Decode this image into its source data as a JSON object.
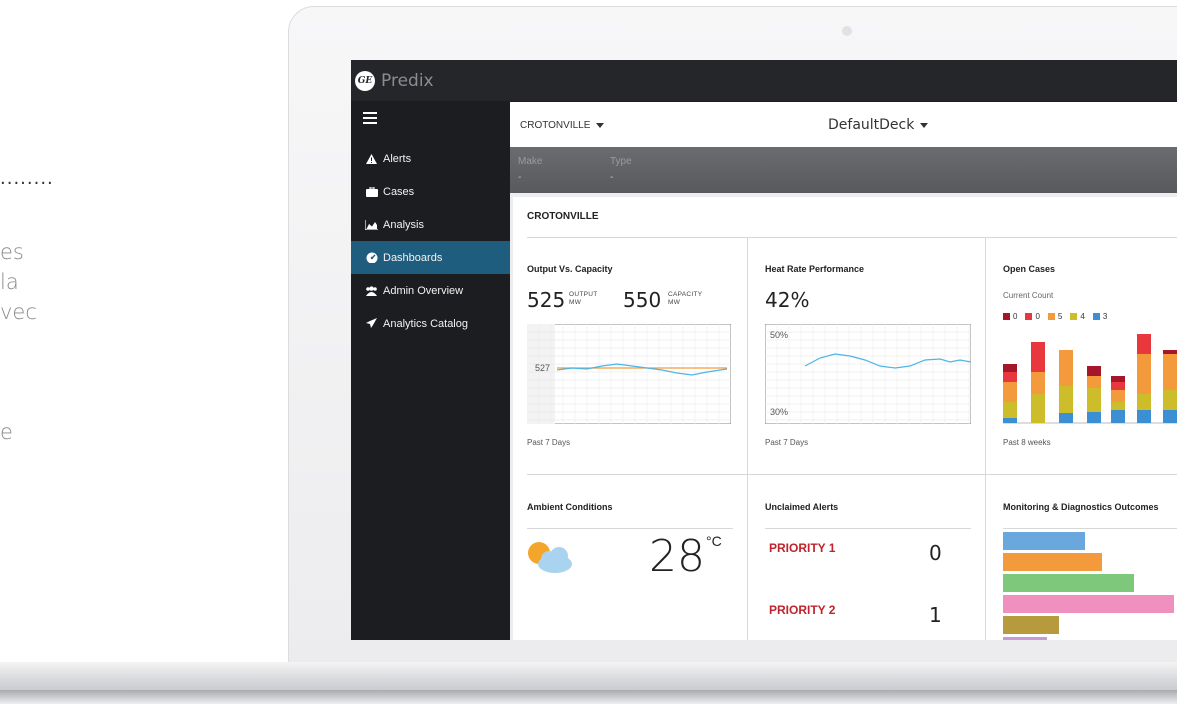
{
  "marketing_fragments": {
    "dots": "........",
    "line1": "es",
    "line2": "la",
    "line3": "vec",
    "line4": "e"
  },
  "app": {
    "brand": "Predix",
    "logo_text": "GE"
  },
  "sidebar": {
    "items": [
      {
        "label": "Alerts",
        "icon": "alert-triangle-icon",
        "active": false
      },
      {
        "label": "Cases",
        "icon": "briefcase-icon",
        "active": false
      },
      {
        "label": "Analysis",
        "icon": "area-chart-icon",
        "active": false
      },
      {
        "label": "Dashboards",
        "icon": "dashboard-gauge-icon",
        "active": true
      },
      {
        "label": "Admin Overview",
        "icon": "users-icon",
        "active": false
      },
      {
        "label": "Analytics Catalog",
        "icon": "rocket-icon",
        "active": false
      }
    ]
  },
  "context": {
    "site": "CROTONVILLE",
    "deck": "DefaultDeck",
    "make_label": "Make",
    "make_value": "-",
    "type_label": "Type",
    "type_value": "-"
  },
  "deck": {
    "title": "CROTONVILLE",
    "output_capacity": {
      "title": "Output Vs. Capacity",
      "output_value": "525",
      "output_unit_line1": "OUTPUT",
      "output_unit_line2": "MW",
      "capacity_value": "550",
      "capacity_unit_line1": "CAPACITY",
      "capacity_unit_line2": "MW",
      "marker_label": "527",
      "footer": "Past 7 Days",
      "colors": {
        "output": "#4cb5e6",
        "capacity": "#f39a3c"
      }
    },
    "heat_rate": {
      "title": "Heat Rate Performance",
      "value": "42%",
      "y_top": "50%",
      "y_bottom": "30%",
      "footer": "Past 7 Days",
      "color": "#4cb5e6"
    },
    "open_cases": {
      "title": "Open Cases",
      "subtitle": "Current Count",
      "legend": [
        {
          "value": "0",
          "color": "#a5162a"
        },
        {
          "value": "0",
          "color": "#e8383d"
        },
        {
          "value": "5",
          "color": "#f39a3c"
        },
        {
          "value": "4",
          "color": "#cdbd2a"
        },
        {
          "value": "3",
          "color": "#3d8fd4"
        }
      ],
      "footer": "Past 8 weeks"
    },
    "ambient": {
      "title": "Ambient Conditions",
      "temperature": "28",
      "unit": "°C",
      "icon": "partly-cloudy-icon"
    },
    "unclaimed_alerts": {
      "title": "Unclaimed Alerts",
      "rows": [
        {
          "label": "PRIORITY 1",
          "value": "0"
        },
        {
          "label": "PRIORITY 2",
          "value": "1"
        }
      ]
    },
    "md_outcomes": {
      "title": "Monitoring & Diagnostics Outcomes",
      "bars": [
        {
          "value": 0.47,
          "color": "#6aa7dd"
        },
        {
          "value": 0.57,
          "color": "#f39a3c"
        },
        {
          "value": 0.75,
          "color": "#7ec87b"
        },
        {
          "value": 0.98,
          "color": "#f090bf"
        },
        {
          "value": 0.32,
          "color": "#b89a3e"
        },
        {
          "value": 0.25,
          "color": "#c79ad6"
        }
      ]
    }
  }
}
